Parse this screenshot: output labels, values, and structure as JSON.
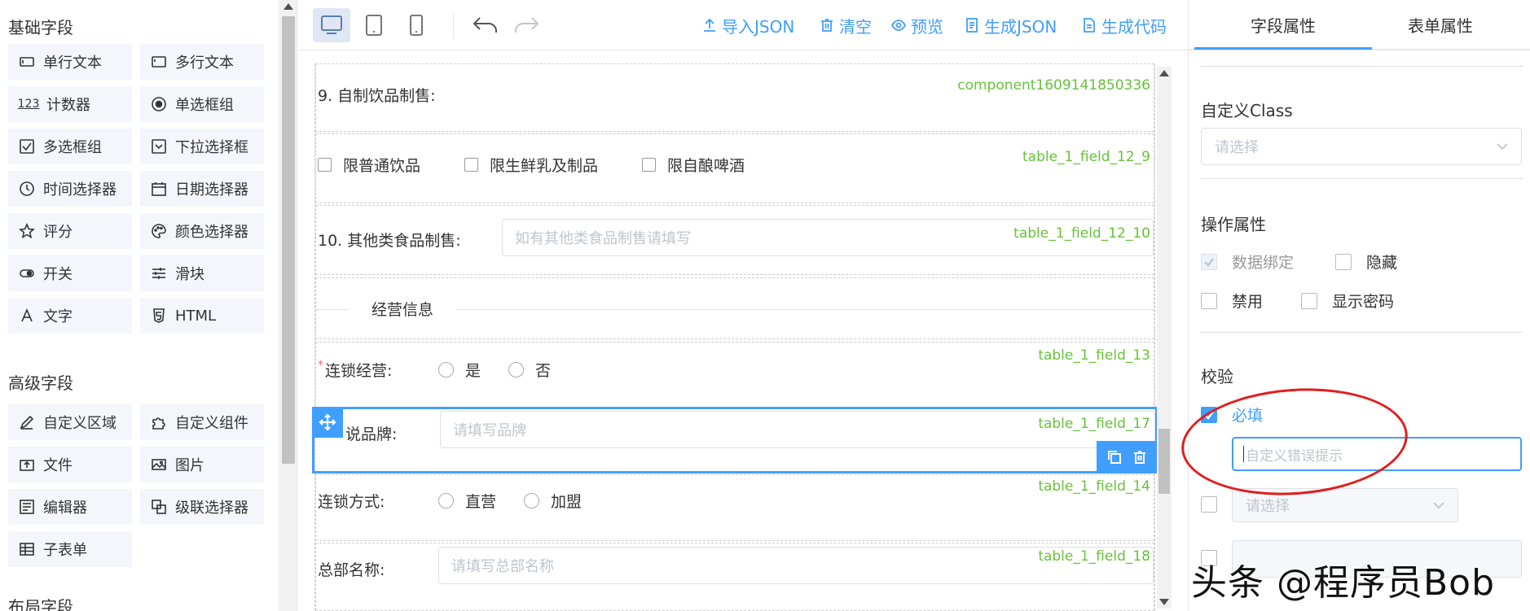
{
  "palette": {
    "basic_title": "基础字段",
    "basic_items": [
      {
        "label": "单行文本",
        "icon": "input-icon"
      },
      {
        "label": "多行文本",
        "icon": "textarea-icon"
      },
      {
        "label": "计数器",
        "icon": "number-icon",
        "glyph": "123"
      },
      {
        "label": "单选框组",
        "icon": "radio-icon"
      },
      {
        "label": "多选框组",
        "icon": "checkbox-icon"
      },
      {
        "label": "下拉选择框",
        "icon": "select-icon"
      },
      {
        "label": "时间选择器",
        "icon": "clock-icon"
      },
      {
        "label": "日期选择器",
        "icon": "calendar-icon"
      },
      {
        "label": "评分",
        "icon": "star-icon"
      },
      {
        "label": "颜色选择器",
        "icon": "palette-icon"
      },
      {
        "label": "开关",
        "icon": "switch-icon"
      },
      {
        "label": "滑块",
        "icon": "slider-icon"
      },
      {
        "label": "文字",
        "icon": "text-icon"
      },
      {
        "label": "HTML",
        "icon": "html-icon"
      }
    ],
    "advanced_title": "高级字段",
    "advanced_items": [
      {
        "label": "自定义区域",
        "icon": "pen-icon"
      },
      {
        "label": "自定义组件",
        "icon": "puzzle-icon"
      },
      {
        "label": "文件",
        "icon": "upload-icon"
      },
      {
        "label": "图片",
        "icon": "image-icon"
      },
      {
        "label": "编辑器",
        "icon": "editor-icon"
      },
      {
        "label": "级联选择器",
        "icon": "cascader-icon"
      },
      {
        "label": "子表单",
        "icon": "table-icon"
      }
    ],
    "layout_title": "布局字段"
  },
  "toolbar": {
    "import_json": "导入JSON",
    "clear": "清空",
    "preview": "预览",
    "generate_json": "生成JSON",
    "generate_code": "生成代码"
  },
  "canvas": {
    "row1": {
      "label": "9. 自制饮品制售:",
      "field_id": "component1609141850336"
    },
    "row2": {
      "options": [
        "限普通饮品",
        "限生鲜乳及制品",
        "限自酿啤酒"
      ],
      "field_id": "table_1_field_12_9"
    },
    "row3": {
      "label": "10. 其他类食品制售:",
      "placeholder": "如有其他类食品制售请填写",
      "field_id": "table_1_field_12_10"
    },
    "divider": {
      "text": "经营信息"
    },
    "row4": {
      "required_mark": "*",
      "label": "连锁经营:",
      "options": [
        "是",
        "否"
      ],
      "field_id": "table_1_field_13"
    },
    "row5": {
      "label": "说品牌:",
      "placeholder": "请填写品牌",
      "field_id": "table_1_field_17"
    },
    "row6": {
      "label": "连锁方式:",
      "options": [
        "直营",
        "加盟"
      ],
      "field_id": "table_1_field_14"
    },
    "row7": {
      "label": "总部名称:",
      "placeholder": "请填写总部名称",
      "field_id": "table_1_field_18"
    }
  },
  "right_panel": {
    "tabs": [
      "字段属性",
      "表单属性"
    ],
    "active_tab": 0,
    "custom_class_label": "自定义Class",
    "custom_class_placeholder": "请选择",
    "operation_label": "操作属性",
    "data_binding": "数据绑定",
    "hidden": "隐藏",
    "disabled": "禁用",
    "show_password": "显示密码",
    "validation_label": "校验",
    "required": "必填",
    "error_placeholder": "自定义错误提示",
    "type_placeholder": "请选择"
  },
  "watermark": "头条 @程序员Bob",
  "colors": {
    "accent": "#409eff",
    "field_id": "#67c23a",
    "annotation": "#e11d1d"
  }
}
